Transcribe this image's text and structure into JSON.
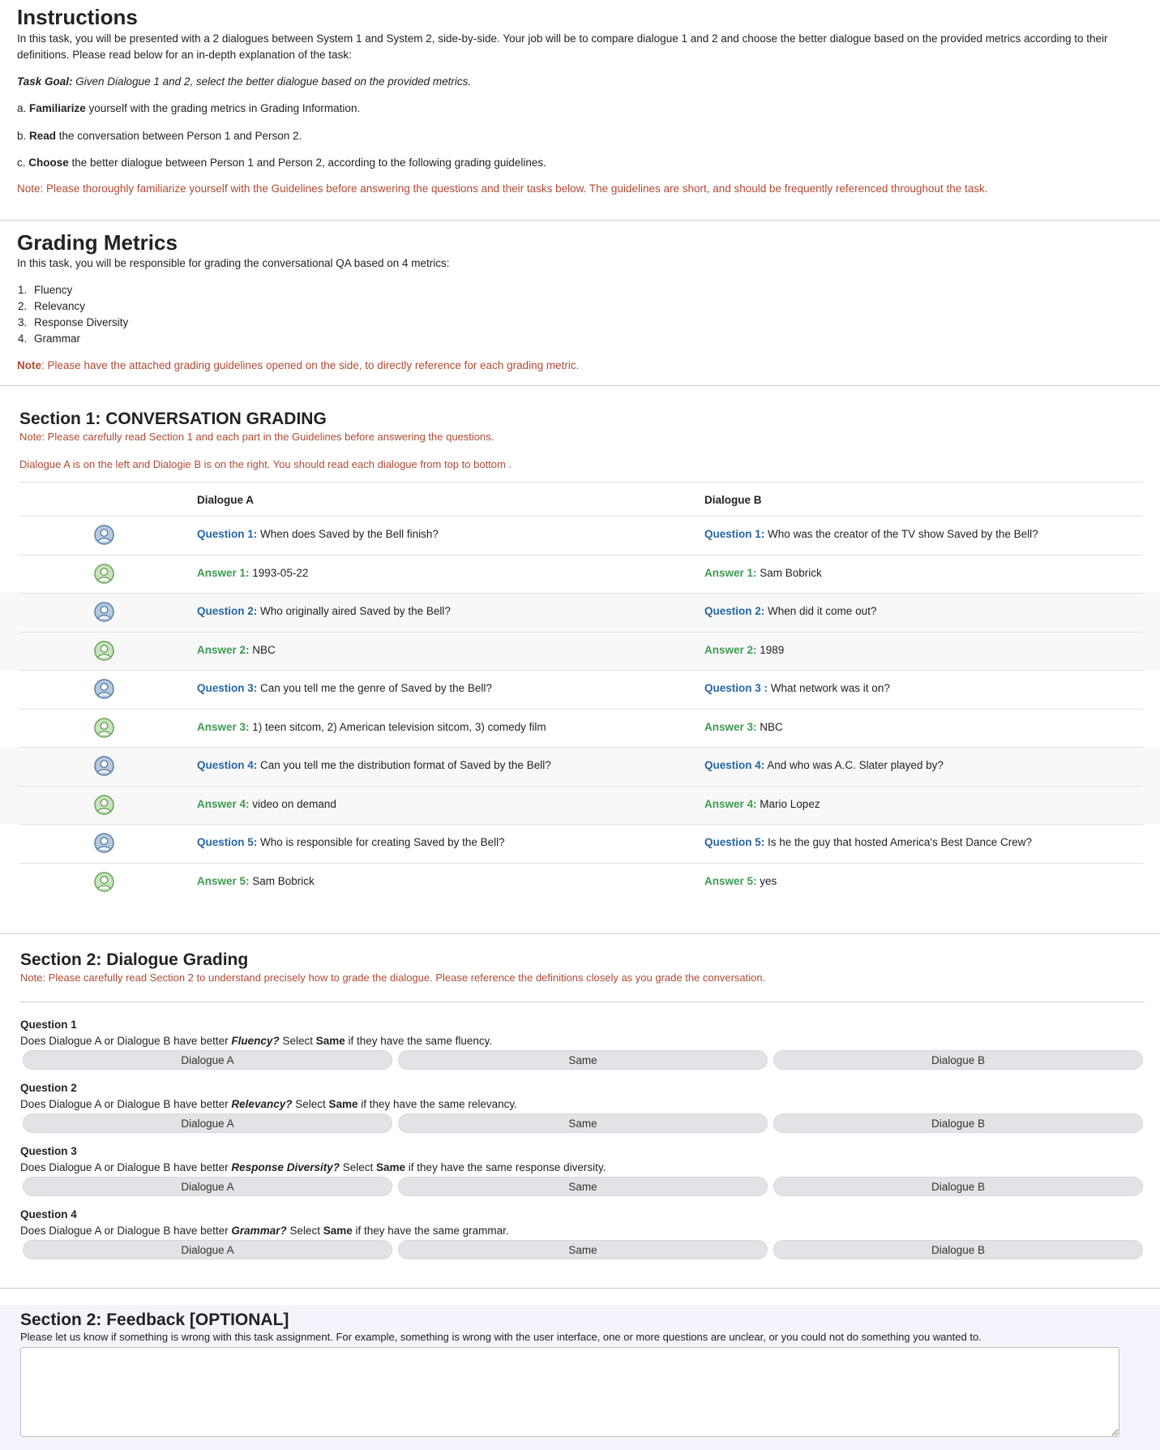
{
  "instructions": {
    "title": "Instructions",
    "intro": "In this task, you will be presented with a 2 dialogues between System 1 and System 2, side-by-side. Your job will be to compare dialogue 1 and 2 and choose the better dialogue based on the provided metrics according to their definitions. Please read below for an in-depth explanation of the task:",
    "goal_label": "Task Goal:",
    "goal_text": " Given Dialogue 1 and 2, select the better dialogue based on the provided metrics.",
    "steps": [
      {
        "prefix": "a. ",
        "bold": "Familiarize",
        "rest": " yourself with the grading metrics in Grading Information."
      },
      {
        "prefix": "b. ",
        "bold": "Read",
        "rest": " the conversation between Person 1 and Person 2."
      },
      {
        "prefix": "c. ",
        "bold": "Choose",
        "rest": " the better dialogue between Person 1 and Person 2, according to the following grading guidelines."
      }
    ],
    "note": "Note: Please thoroughly familiarize yourself with the Guidelines before answering the questions and their tasks below. The guidelines are short, and should be frequently referenced throughout the task."
  },
  "metrics": {
    "title": "Grading Metrics",
    "intro": "In this task, you will be responsible for grading the conversational QA based on 4 metrics:",
    "items": [
      "Fluency",
      "Relevancy",
      "Response Diversity",
      "Grammar"
    ],
    "note_label": "Note",
    "note_text": ": Please have the attached grading guidelines opened on the side, to directly reference for each grading metric."
  },
  "section1": {
    "title": "Section 1: CONVERSATION GRADING",
    "note": "Note: Please carefully read Section 1 and each part in the Guidelines before answering the questions.",
    "note2": "Dialogue A is on the left and Dialogie B is on the right. You should read each dialogue from top to bottom .",
    "col_a": "Dialogue A",
    "col_b": "Dialogue B",
    "rows": [
      {
        "a_label": "Question 1:",
        "a_text": " When does Saved by the Bell finish?",
        "b_label": "Question 1:",
        "b_text": " Who was the creator of the TV show Saved by the Bell?"
      },
      {
        "a_label": "Answer 1:",
        "a_text": " 1993-05-22",
        "b_label": "Answer 1:",
        "b_text": " Sam Bobrick"
      },
      {
        "a_label": "Question 2:",
        "a_text": " Who originally aired Saved by the Bell?",
        "b_label": "Question 2:",
        "b_text": " When did it come out?"
      },
      {
        "a_label": "Answer 2:",
        "a_text": " NBC",
        "b_label": "Answer 2:",
        "b_text": " 1989"
      },
      {
        "a_label": "Question 3:",
        "a_text": " Can you tell me the genre of Saved by the Bell?",
        "b_label": "Question 3 :",
        "b_text": " What network was it on?"
      },
      {
        "a_label": "Answer 3:",
        "a_text": " 1) teen sitcom, 2) American television sitcom, 3) comedy film",
        "b_label": "Answer 3:",
        "b_text": " NBC"
      },
      {
        "a_label": "Question 4:",
        "a_text": " Can you tell me the distribution format of Saved by the Bell?",
        "b_label": "Question 4:",
        "b_text": " And who was A.C. Slater played by?"
      },
      {
        "a_label": "Answer 4:",
        "a_text": " video on demand",
        "b_label": "Answer 4:",
        "b_text": " Mario Lopez"
      },
      {
        "a_label": "Question 5:",
        "a_text": " Who is responsible for creating Saved by the Bell?",
        "b_label": "Question 5:",
        "b_text": " Is he the guy that hosted America's Best Dance Crew?"
      },
      {
        "a_label": "Answer 5:",
        "a_text": " Sam Bobrick",
        "b_label": "Answer 5:",
        "b_text": " yes"
      }
    ],
    "avatars": [
      "person-icon-blue",
      "person-icon-green"
    ]
  },
  "section2": {
    "title": "Section 2: Dialogue Grading",
    "note": "Note: Please carefully read Section 2 to understand precisely how to grade the dialogue. Please reference the definitions closely as you grade the conversation.",
    "questions": [
      {
        "title": "Question 1",
        "pre": "Does Dialogue A or Dialogue B have better ",
        "metric": "Fluency?",
        "mid": " Select ",
        "same": "Same",
        "post": " if they have the same fluency."
      },
      {
        "title": "Question 2",
        "pre": "Does Dialogue A or Dialogue B have better ",
        "metric": "Relevancy?",
        "mid": " Select ",
        "same": "Same",
        "post": " if they have the same relevancy."
      },
      {
        "title": "Question 3",
        "pre": "Does Dialogue A or Dialogue B have better ",
        "metric": "Response Diversity?",
        "mid": " Select ",
        "same": "Same",
        "post": " if they have the same response diversity."
      },
      {
        "title": "Question 4",
        "pre": "Does Dialogue A or Dialogue B have better ",
        "metric": "Grammar?",
        "mid": " Select ",
        "same": "Same",
        "post": " if they have the same grammar."
      }
    ],
    "options": [
      "Dialogue A",
      "Same",
      "Dialogue B"
    ]
  },
  "feedback": {
    "title": "Section 2: Feedback [OPTIONAL]",
    "text": "Please let us know if something is wrong with this task assignment. For example, something is wrong with the user interface, one or more questions are unclear, or you could not do something you wanted to.",
    "value": ""
  },
  "colors": {
    "question_label": "#2666a3",
    "answer_label": "#3d9a52",
    "note": "#b04a34"
  }
}
